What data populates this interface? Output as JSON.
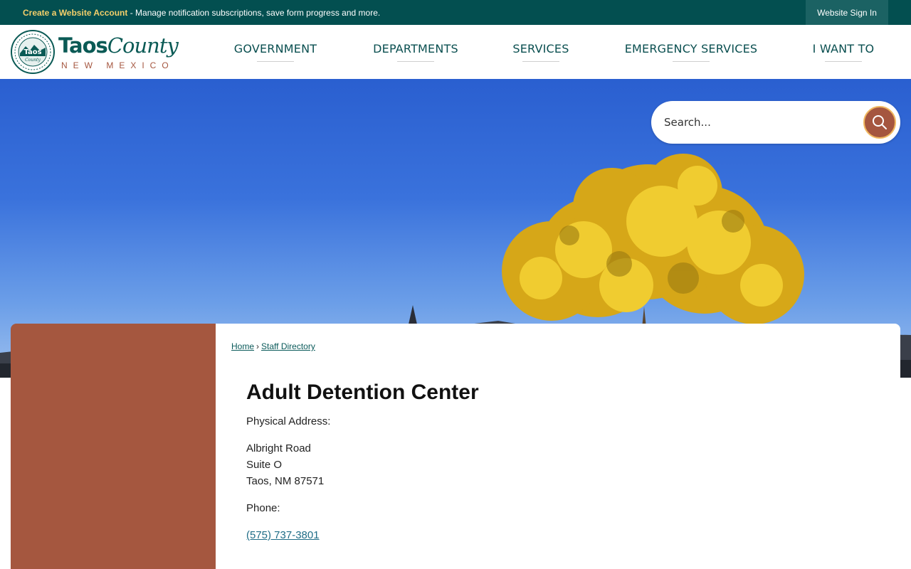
{
  "topbar": {
    "create_link": "Create a Website Account",
    "message": " - Manage notification subscriptions, save form progress and more.",
    "signin": "Website Sign In"
  },
  "logo": {
    "seal_text": "Taos",
    "seal_sub": "County",
    "name_bold": "Taos",
    "name_script": "County",
    "sub": "NEW MEXICO"
  },
  "nav": [
    {
      "label": "GOVERNMENT"
    },
    {
      "label": "DEPARTMENTS"
    },
    {
      "label": "SERVICES"
    },
    {
      "label": "EMERGENCY SERVICES"
    },
    {
      "label": "I WANT TO"
    }
  ],
  "search": {
    "placeholder": "Search..."
  },
  "breadcrumb": {
    "home": "Home",
    "separator": "›",
    "current": "Staff Directory"
  },
  "main": {
    "title": "Adult Detention Center",
    "address_label": "Physical Address:",
    "address_line1": "Albright Road",
    "address_line2": "Suite O",
    "address_line3": "Taos, NM 87571",
    "phone_label": "Phone:",
    "phone": "(575) 737-3801"
  },
  "colors": {
    "topbar": "#034f50",
    "accent": "#a5573f",
    "link": "#0a5a5a"
  },
  "icons": {
    "search": "search-icon"
  }
}
